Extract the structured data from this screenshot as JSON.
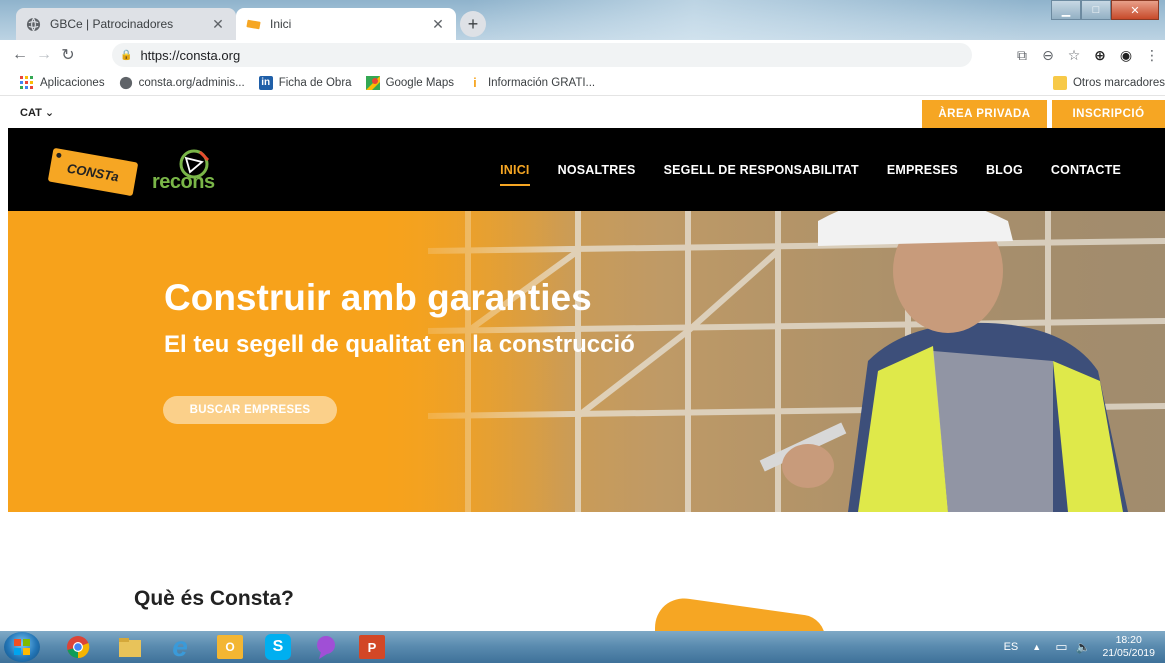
{
  "browser": {
    "tabs": [
      {
        "title": "GBCe | Patrocinadores",
        "active": false
      },
      {
        "title": "Inici",
        "active": true
      }
    ],
    "url": "https://consta.org",
    "bookmarks": [
      {
        "label": "Aplicaciones",
        "icon": "apps-grid-icon"
      },
      {
        "label": "consta.org/adminis...",
        "icon": "globe-icon"
      },
      {
        "label": "Ficha de Obra",
        "icon": "linkedin-icon"
      },
      {
        "label": "Google Maps",
        "icon": "maps-pin-icon"
      },
      {
        "label": "Información GRATI...",
        "icon": "info-icon"
      }
    ],
    "other_bookmarks": "Otros marcadores"
  },
  "site": {
    "lang": "CAT",
    "private_area": "ÀREA PRIVADA",
    "signup": "INSCRIPCIÓ",
    "logo_text": "CONSTa",
    "partner_logo_text": "recons",
    "nav": [
      "INICI",
      "NOSALTRES",
      "SEGELL DE RESPONSABILITAT",
      "EMPRESES",
      "BLOG",
      "CONTACTE"
    ],
    "active_nav": "INICI",
    "hero": {
      "title": "Construir amb garanties",
      "subtitle": "El teu segell de qualitat en la construcció",
      "cta": "BUSCAR EMPRESES"
    },
    "section_title": "Què és Consta?"
  },
  "taskbar": {
    "apps": [
      "chrome-icon",
      "file-explorer-icon",
      "internet-explorer-icon",
      "outlook-icon",
      "skype-icon",
      "messenger-icon",
      "powerpoint-icon"
    ],
    "lang": "ES",
    "time": "18:20",
    "date": "21/05/2019"
  },
  "colors": {
    "accent": "#f6a623",
    "header_bg": "#000000"
  }
}
